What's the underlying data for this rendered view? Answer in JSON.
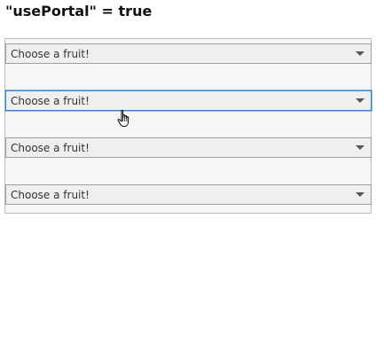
{
  "heading": "\"usePortal\" = true",
  "selects": [
    {
      "placeholder": "Choose a fruit!"
    },
    {
      "placeholder": "Choose a fruit!"
    },
    {
      "placeholder": "Choose a fruit!"
    },
    {
      "placeholder": "Choose a fruit!"
    }
  ],
  "icons": {
    "dropdown": "chevron-down-icon",
    "pointer": "hand-pointer-icon"
  },
  "colors": {
    "focus_border": "#3b7fc4",
    "panel_background": "#f6f6f6"
  }
}
